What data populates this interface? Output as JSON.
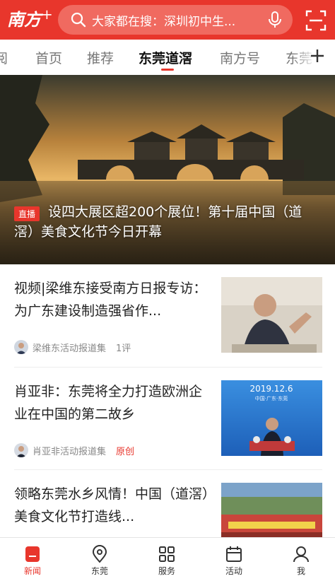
{
  "header": {
    "logo_text": "南方",
    "logo_plus": "+",
    "search_placeholder": "大家都在搜：深圳初中生...",
    "icons": [
      "search-icon",
      "microphone-icon",
      "scan-icon"
    ]
  },
  "tabs": [
    {
      "label": "阅"
    },
    {
      "label": "首页"
    },
    {
      "label": "推荐"
    },
    {
      "label": "东莞道滘"
    },
    {
      "label": "南方号"
    },
    {
      "label": "东莞"
    }
  ],
  "active_tab": "东莞道滘",
  "hero": {
    "badge": "直播",
    "headline": "设四大展区超200个展位！第十届中国（道滘）美食文化节今日开幕"
  },
  "articles": [
    {
      "title": "视频|梁维东接受南方日报专访：为广东建设制造强省作...",
      "source": "梁维东活动报道集",
      "extra": "1评",
      "extra_red": false
    },
    {
      "title": "肖亚非：东莞将全力打造欧洲企业在中国的第二故乡",
      "source": "肖亚非活动报道集",
      "extra": "原创",
      "extra_red": true,
      "thumb_text": "2019.12.6",
      "thumb_sub": "中国·广东·东莞"
    },
    {
      "title": "领略东莞水乡风情！中国（道滘）美食文化节打造线..."
    }
  ],
  "bottom_nav": [
    {
      "label": "新闻",
      "icon": "news-icon",
      "active": true
    },
    {
      "label": "东莞",
      "icon": "location-icon",
      "active": false
    },
    {
      "label": "服务",
      "icon": "grid-icon",
      "active": false
    },
    {
      "label": "活动",
      "icon": "calendar-icon",
      "active": false
    },
    {
      "label": "我",
      "icon": "user-icon",
      "active": false
    }
  ],
  "colors": {
    "brand": "#e8362c",
    "tab_inactive": "#777777",
    "meta": "#888888"
  }
}
